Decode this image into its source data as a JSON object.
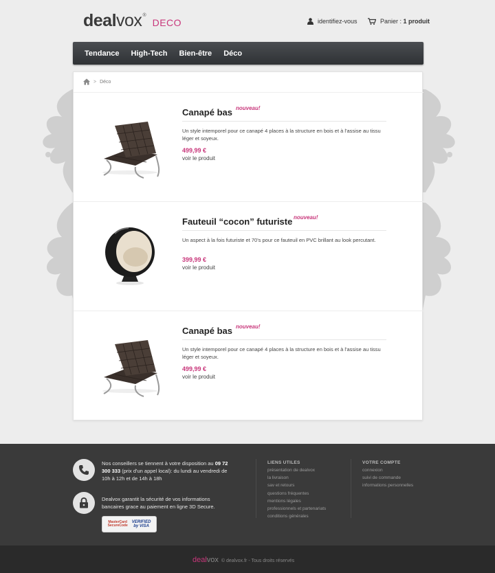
{
  "header": {
    "logo_deal": "deal",
    "logo_vox": "vox",
    "logo_reg": "®",
    "logo_sub": "DECO",
    "login_label": "identifiez-vous",
    "cart_prefix": "Panier :",
    "cart_count": "1 produit"
  },
  "nav": {
    "items": [
      "Tendance",
      "High-Tech",
      "Bien-être",
      "Déco"
    ]
  },
  "breadcrumb": {
    "separator": ">",
    "current": "Déco"
  },
  "products": [
    {
      "title": "Canapé bas",
      "badge": "nouveau!",
      "description": "Un style intemporel pour ce canapé 4 places à la structure en bois et à l'assise au tissu léger et soyeux.",
      "price": "499,99 €",
      "link": "voir le produit",
      "image": "barcelona-chair"
    },
    {
      "title": "Fauteuil “cocon” futuriste",
      "badge": "nouveau!",
      "description": "Un aspect à la fois futuriste et 70's pour ce fauteuil en PVC brillant au look percutant.",
      "price": "399,99 €",
      "link": "voir le produit",
      "image": "ball-chair"
    },
    {
      "title": "Canapé bas",
      "badge": "nouveau!",
      "description": "Un style intemporel pour ce canapé 4 places à la structure en bois et à l'assise au tissu léger et soyeux.",
      "price": "499,99 €",
      "link": "voir le produit",
      "image": "barcelona-chair"
    }
  ],
  "footer": {
    "contact_text_1": "Nos conseillers se tiennent à votre disposition au",
    "contact_phone": "09 72 300 333",
    "contact_text_2": "(prix d'un appel local): du lundi au vendredi de 10h à 12h et de 14h à 18h",
    "secure_text": "Dealvox garantit la sécurité de vos informations bancaires grace au paiement en ligne 3D Secure.",
    "badge_mc_1": "MasterCard",
    "badge_mc_2": "SecureCode",
    "badge_visa_1": "VERIFIED",
    "badge_visa_2": "by VISA",
    "links_title": "LIENS UTILES",
    "links": [
      "présentation de dealvox",
      "la livraison",
      "sav et retours",
      "questions fréquentes",
      "mentions légales",
      "professionnels et partenariats",
      "conditions générales"
    ],
    "account_title": "VOTRE COMPTE",
    "account_links": [
      "connexion",
      "suivi de commande",
      "informations personnelles"
    ],
    "bottom_logo_deal": "deal",
    "bottom_logo_vox": "vox",
    "copyright": "© dealvox.fr - Tous droits réservés"
  },
  "colors": {
    "accent": "#c8377b",
    "nav_bg": "#3c3f42",
    "footer_bg": "#3a3a3a",
    "footer_bottom_bg": "#2a2a2a"
  }
}
